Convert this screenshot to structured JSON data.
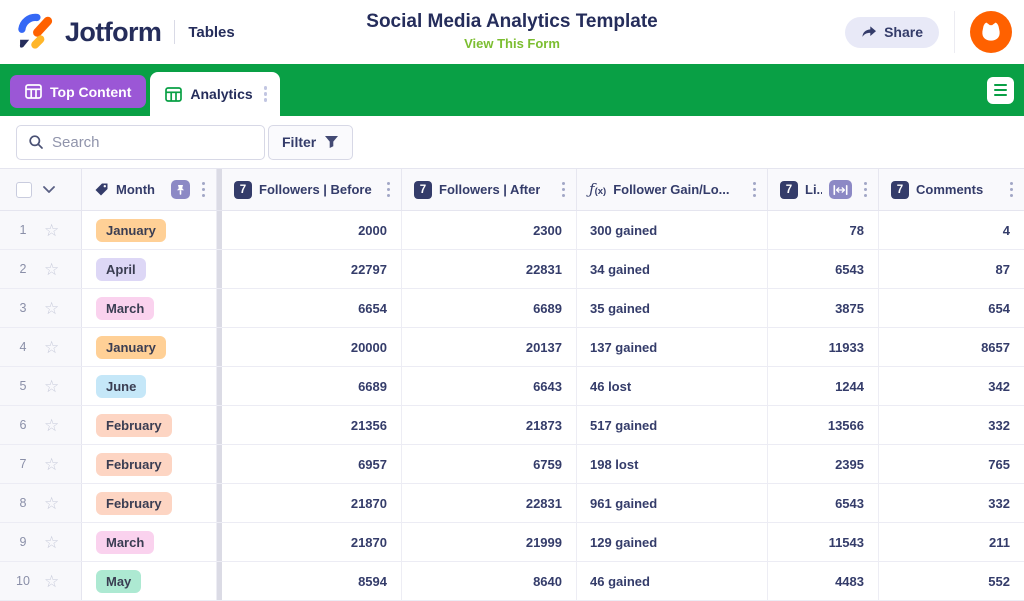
{
  "topbar": {
    "brand": "Jotform",
    "product": "Tables",
    "title": "Social Media Analytics Template",
    "view_link": "View This Form",
    "share_label": "Share"
  },
  "tabs": {
    "top_content": "Top Content",
    "analytics": "Analytics"
  },
  "toolbar": {
    "search_placeholder": "Search",
    "filter_label": "Filter"
  },
  "icons": {
    "number_badge": "7",
    "formula_glyph": "ƒ",
    "formula_sub": "(x)",
    "star_glyph": "☆"
  },
  "table": {
    "columns": {
      "month": "Month",
      "followers_before": "Followers | Before",
      "followers_after": "Followers | After",
      "follower_gain": "Follower Gain/Lo...",
      "likes": "Li...",
      "comments": "Comments"
    },
    "rows": [
      {
        "num": "1",
        "month": "January",
        "month_bg": "#FFD096",
        "before": "2000",
        "after": "2300",
        "gain": "300 gained",
        "likes": "78",
        "comments": "4"
      },
      {
        "num": "2",
        "month": "April",
        "month_bg": "#DDD7F6",
        "before": "22797",
        "after": "22831",
        "gain": "34 gained",
        "likes": "6543",
        "comments": "87"
      },
      {
        "num": "3",
        "month": "March",
        "month_bg": "#FAD2EE",
        "before": "6654",
        "after": "6689",
        "gain": "35 gained",
        "likes": "3875",
        "comments": "654"
      },
      {
        "num": "4",
        "month": "January",
        "month_bg": "#FFD096",
        "before": "20000",
        "after": "20137",
        "gain": "137 gained",
        "likes": "11933",
        "comments": "8657"
      },
      {
        "num": "5",
        "month": "June",
        "month_bg": "#C5E7F8",
        "before": "6689",
        "after": "6643",
        "gain": "46 lost",
        "likes": "1244",
        "comments": "342"
      },
      {
        "num": "6",
        "month": "February",
        "month_bg": "#FDD5C3",
        "before": "21356",
        "after": "21873",
        "gain": "517 gained",
        "likes": "13566",
        "comments": "332"
      },
      {
        "num": "7",
        "month": "February",
        "month_bg": "#FDD5C3",
        "before": "6957",
        "after": "6759",
        "gain": "198 lost",
        "likes": "2395",
        "comments": "765"
      },
      {
        "num": "8",
        "month": "February",
        "month_bg": "#FDD5C3",
        "before": "21870",
        "after": "22831",
        "gain": "961 gained",
        "likes": "6543",
        "comments": "332"
      },
      {
        "num": "9",
        "month": "March",
        "month_bg": "#FAD2EE",
        "before": "21870",
        "after": "21999",
        "gain": "129 gained",
        "likes": "11543",
        "comments": "211"
      },
      {
        "num": "10",
        "month": "May",
        "month_bg": "#ADE9D2",
        "before": "8594",
        "after": "8640",
        "gain": "46 gained",
        "likes": "4483",
        "comments": "552"
      }
    ]
  },
  "colors": {
    "brand_green": "#09A045",
    "tab_purple": "#9B57D6",
    "link_green": "#7CBE31",
    "accent_orange": "#FF6100",
    "navy": "#252D5B"
  }
}
